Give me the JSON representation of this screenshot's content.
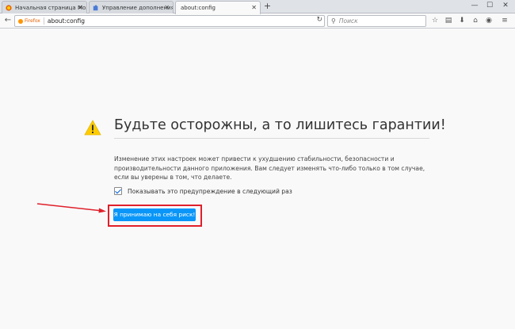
{
  "tabs": [
    {
      "label": "Начальная страница Mo...",
      "icon": "firefox-icon",
      "active": false
    },
    {
      "label": "Управление дополнения...",
      "icon": "puzzle-icon",
      "active": false
    },
    {
      "label": "about:config",
      "icon": "none",
      "active": true
    }
  ],
  "new_tab_label": "+",
  "window_controls": {
    "minimize": "—",
    "maximize": "☐",
    "close": "✕"
  },
  "navbar": {
    "brand": "Firefox",
    "url": "about:config",
    "search_placeholder": "Поиск"
  },
  "warning": {
    "title": "Будьте осторожны, а то лишитесь гарантии!",
    "text": "Изменение этих настроек может привести к ухудшению стабильности, безопасности и производительности данного приложения. Вам следует изменять что-либо только в том случае, если вы уверены в том, что делаете.",
    "checkbox_label": "Показывать это предупреждение в следующий раз",
    "checkbox_checked": true,
    "accept_button": "Я принимаю на себя риск!"
  },
  "colors": {
    "accent": "#0996f8",
    "annotation": "#e0202a",
    "warning": "#ffcc00"
  }
}
